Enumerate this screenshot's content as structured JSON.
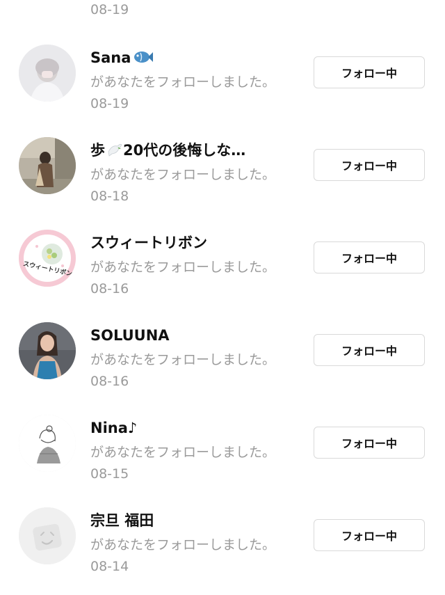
{
  "partial_top": {
    "date": "08-19"
  },
  "notifications": [
    {
      "name": "Sana",
      "emoji_icon": "fish-icon",
      "message": "があなたをフォローしました。",
      "date": "08-19",
      "button_label": "フォロー中"
    },
    {
      "name": "歩",
      "name_rest": "20代の後悔しな…",
      "emoji_icon": "dove-icon",
      "message": "があなたをフォローしました。",
      "date": "08-18",
      "button_label": "フォロー中"
    },
    {
      "name": "スウィートリボン",
      "avatar_text": "スウィートリボン",
      "message": "があなたをフォローしました。",
      "date": "08-16",
      "button_label": "フォロー中"
    },
    {
      "name": "SOLUUNA",
      "message": "があなたをフォローしました。",
      "date": "08-16",
      "button_label": "フォロー中"
    },
    {
      "name": "Nina♪",
      "message": "があなたをフォローしました。",
      "date": "08-15",
      "button_label": "フォロー中"
    },
    {
      "name": "宗旦 福田",
      "message": "があなたをフォローしました。",
      "date": "08-14",
      "button_label": "フォロー中"
    }
  ],
  "colors": {
    "secondary_text": "#9a9a9a",
    "button_border": "#d9d9d9",
    "primary_text": "#111111"
  }
}
